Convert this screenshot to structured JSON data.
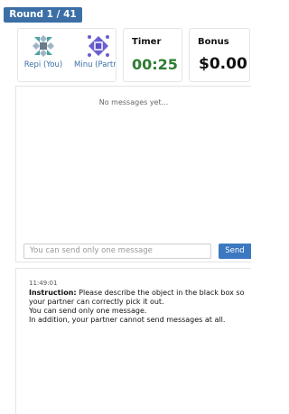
{
  "round": {
    "label": "Round 1 / 41"
  },
  "players": [
    {
      "name": "Repi (You)",
      "icon": "repi-avatar-icon",
      "color": "#3a6ea5"
    },
    {
      "name": "Minu (Partner)",
      "icon": "minu-avatar-icon",
      "color": "#5b4fc4"
    }
  ],
  "timer": {
    "title": "Timer",
    "value": "00:25",
    "color": "#2e7d32"
  },
  "bonus": {
    "title": "Bonus",
    "value": "$0.00"
  },
  "chat": {
    "empty_text": "No messages yet...",
    "input_placeholder": "You can send only one message",
    "send_label": "Send"
  },
  "log": {
    "timestamp": "11:49:01",
    "instruction_label": "Instruction:",
    "instruction_text": " Please describe the object in the black box so your partner can correctly pick it out.",
    "line2": "You can send only one message.",
    "line3": "In addition, your partner cannot send messages at all."
  },
  "colors": {
    "accent": "#3b6fa6",
    "send_button": "#3b78c0"
  }
}
